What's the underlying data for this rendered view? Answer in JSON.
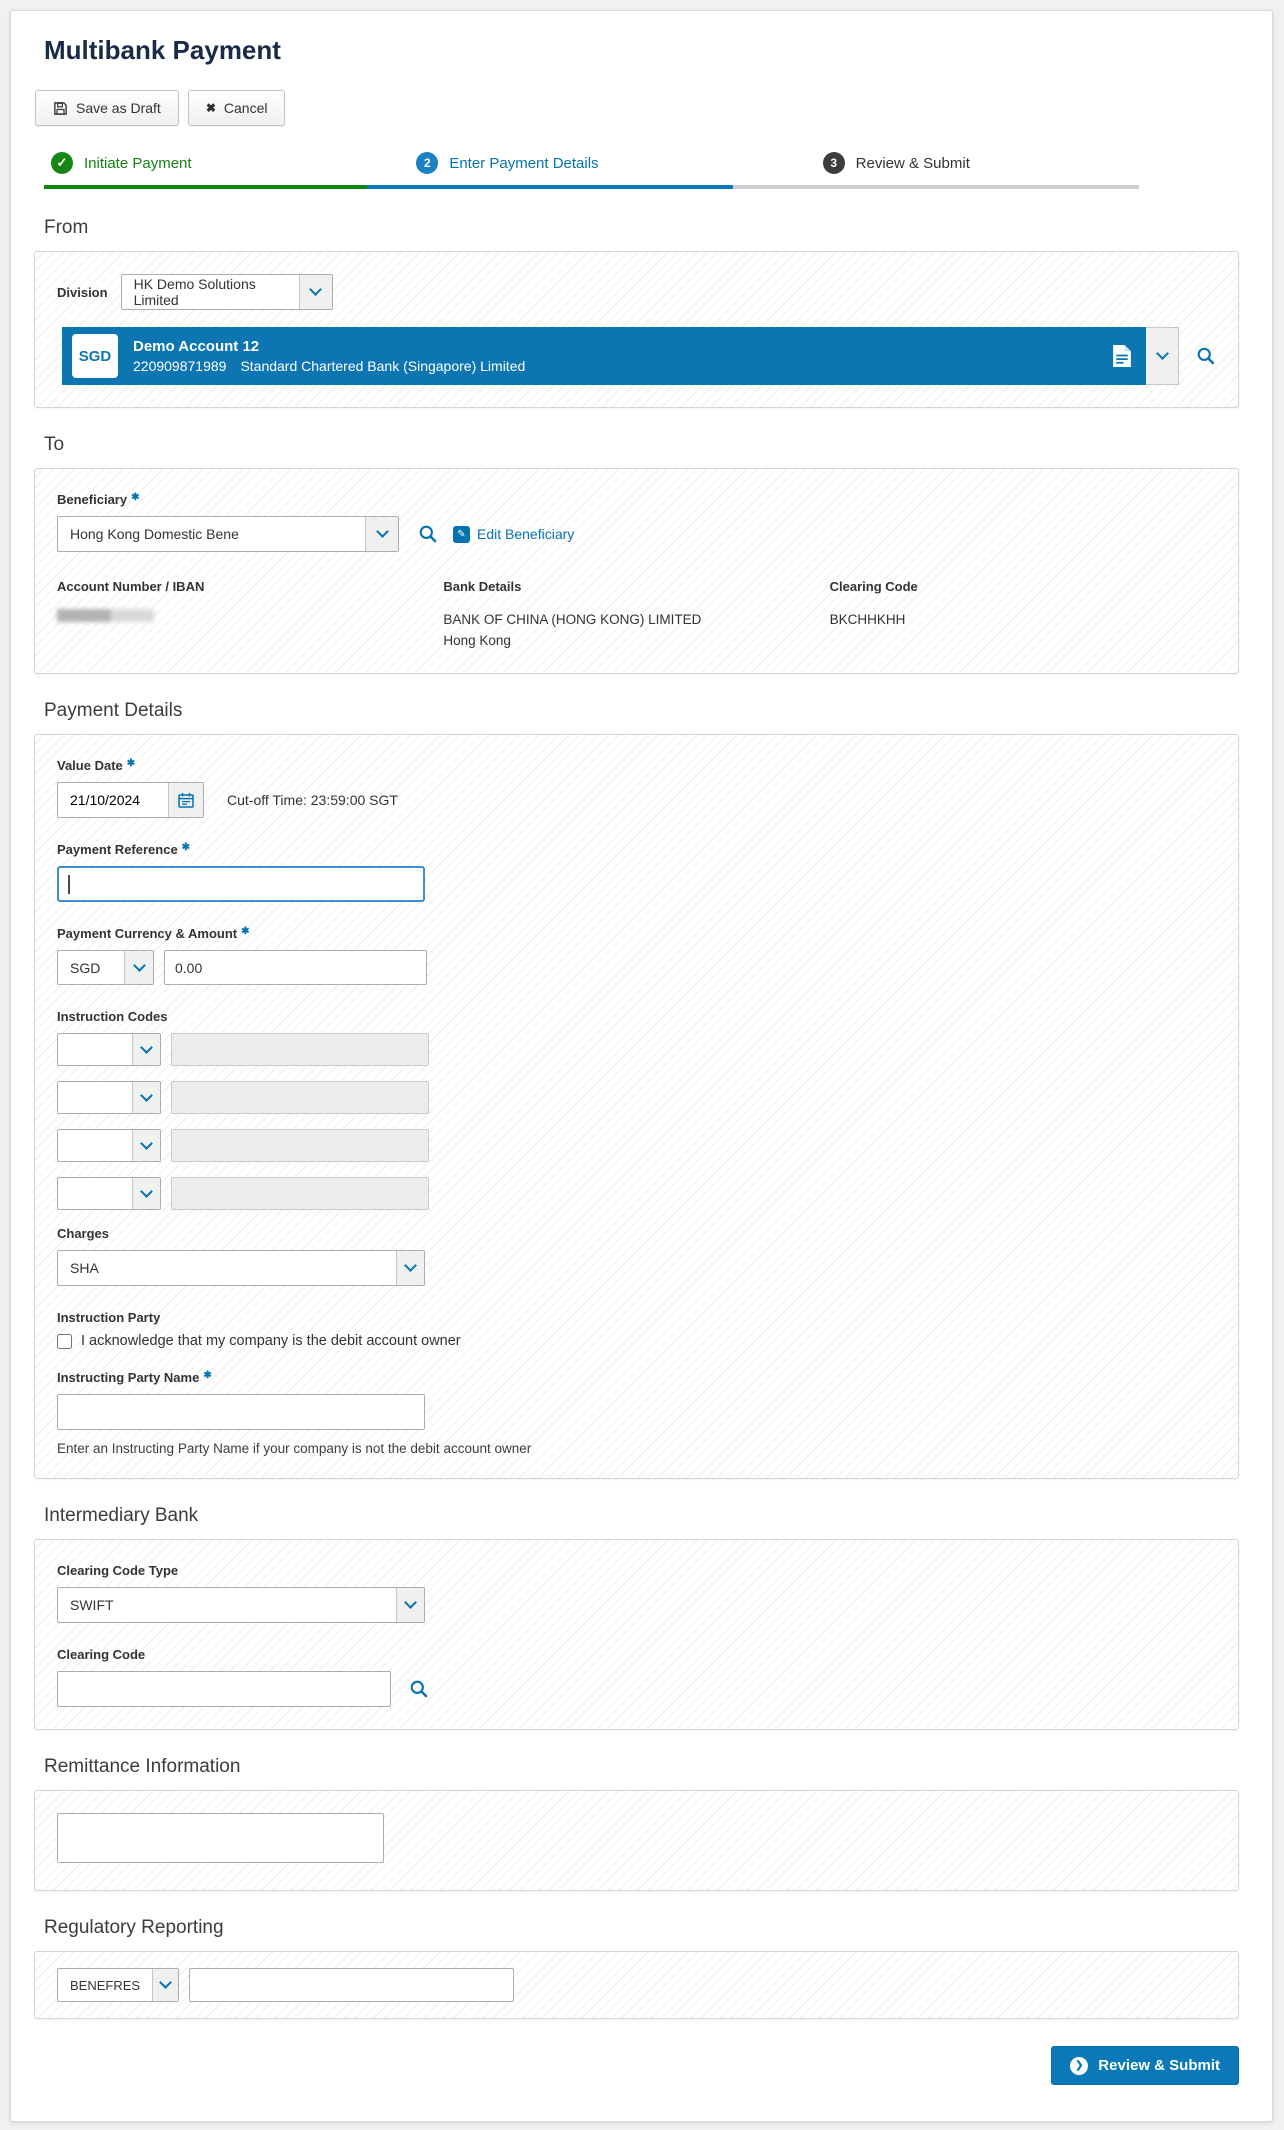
{
  "page": {
    "title": "Multibank Payment"
  },
  "required_marker": "✱",
  "icons": {
    "check": "✓",
    "cancel_x": "✖",
    "pencil": "✎",
    "arrow_right": "❯"
  },
  "toolbar": {
    "save_draft_label": "Save as Draft",
    "cancel_label": "Cancel"
  },
  "steps": [
    {
      "num": "",
      "label": "Initiate Payment",
      "state": "completed"
    },
    {
      "num": "2",
      "label": "Enter Payment Details",
      "state": "active"
    },
    {
      "num": "3",
      "label": "Review & Submit",
      "state": "pending"
    }
  ],
  "from_section": {
    "heading": "From",
    "division_label": "Division",
    "division_value": "HK Demo Solutions Limited",
    "account": {
      "currency": "SGD",
      "name": "Demo Account 12",
      "number": "220909871989",
      "bank": "Standard Chartered Bank (Singapore) Limited"
    }
  },
  "to_section": {
    "heading": "To",
    "beneficiary_label": "Beneficiary",
    "beneficiary_value": "Hong Kong Domestic Bene",
    "edit_beneficiary_label": "Edit Beneficiary",
    "account_number_label": "Account Number / IBAN",
    "bank_details_label": "Bank Details",
    "bank_name": "BANK OF CHINA (HONG KONG) LIMITED",
    "bank_city": "Hong Kong",
    "clearing_code_label": "Clearing Code",
    "clearing_code_value": "BKCHHKHH"
  },
  "payment_details": {
    "heading": "Payment Details",
    "value_date_label": "Value Date",
    "value_date": "21/10/2024",
    "cutoff_text": "Cut-off Time: 23:59:00 SGT",
    "payment_reference_label": "Payment Reference",
    "payment_reference_value": "",
    "currency_amount_label": "Payment Currency & Amount",
    "currency_value": "SGD",
    "amount_value": "0.00",
    "instruction_codes_label": "Instruction Codes",
    "instruction_rows": [
      {
        "code": "",
        "description": ""
      },
      {
        "code": "",
        "description": ""
      },
      {
        "code": "",
        "description": ""
      },
      {
        "code": "",
        "description": ""
      }
    ],
    "charges_label": "Charges",
    "charges_value": "SHA",
    "instruction_party_label": "Instruction Party",
    "acknowledge_text": "I acknowledge that my company is the debit account owner",
    "instructing_party_label": "Instructing Party Name",
    "instructing_party_value": "",
    "helper_text": "Enter an Instructing Party Name if your company is not the debit account owner"
  },
  "intermediary_bank": {
    "heading": "Intermediary Bank",
    "clearing_code_type_label": "Clearing Code Type",
    "clearing_code_type_value": "SWIFT",
    "clearing_code_label": "Clearing Code",
    "clearing_code_value": ""
  },
  "remittance": {
    "heading": "Remittance Information",
    "value": ""
  },
  "regulatory": {
    "heading": "Regulatory Reporting",
    "code_value": "BENEFRES",
    "detail_value": ""
  },
  "footer": {
    "review_submit_label": "Review & Submit"
  },
  "colors": {
    "accent_blue": "#0473ae",
    "account_blue": "#0d76b2",
    "step_green": "#168716",
    "step_blue": "#0b7ab8",
    "title_navy": "#1a2b49",
    "submit_blue": "#0b79b7"
  }
}
